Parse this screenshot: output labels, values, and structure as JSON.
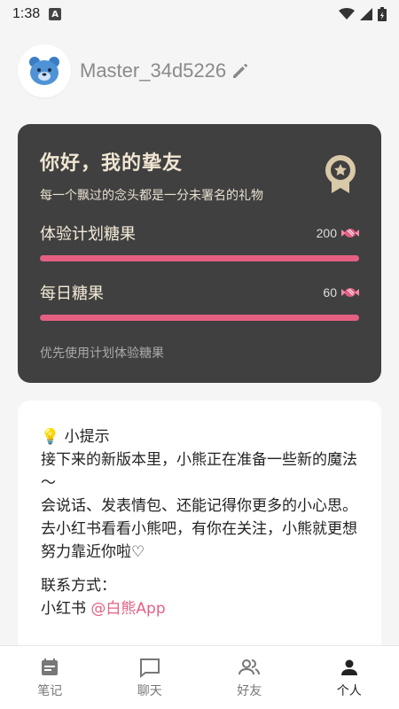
{
  "status": {
    "time": "1:38",
    "notif_letter": "A"
  },
  "profile": {
    "username": "Master_34d5226"
  },
  "card": {
    "title": "你好，我的挚友",
    "subtitle": "每一个飘过的念头都是一分未署名的礼物",
    "rows": [
      {
        "label": "体验计划糖果",
        "value": "200"
      },
      {
        "label": "每日糖果",
        "value": "60"
      }
    ],
    "hint": "优先使用计划体验糖果"
  },
  "tips": {
    "heading": "小提示",
    "lines": [
      "接下来的新版本里，小熊正在准备一些新的魔法～",
      "会说话、发表情包、还能记得你更多的小心思。",
      "去小红书看看小熊吧，有你在关注，小熊就更想努力靠近你啦♡"
    ],
    "contact_label": "联系方式：",
    "contact_platform": "小红书",
    "contact_handle": "@白熊App"
  },
  "tabs": [
    {
      "label": "笔记",
      "icon": "notes-icon"
    },
    {
      "label": "聊天",
      "icon": "chat-icon"
    },
    {
      "label": "好友",
      "icon": "friends-icon"
    },
    {
      "label": "个人",
      "icon": "person-icon",
      "active": true
    }
  ],
  "colors": {
    "accent": "#e55f83",
    "card_dark": "#404040",
    "title_cream": "#f0e6d2"
  }
}
